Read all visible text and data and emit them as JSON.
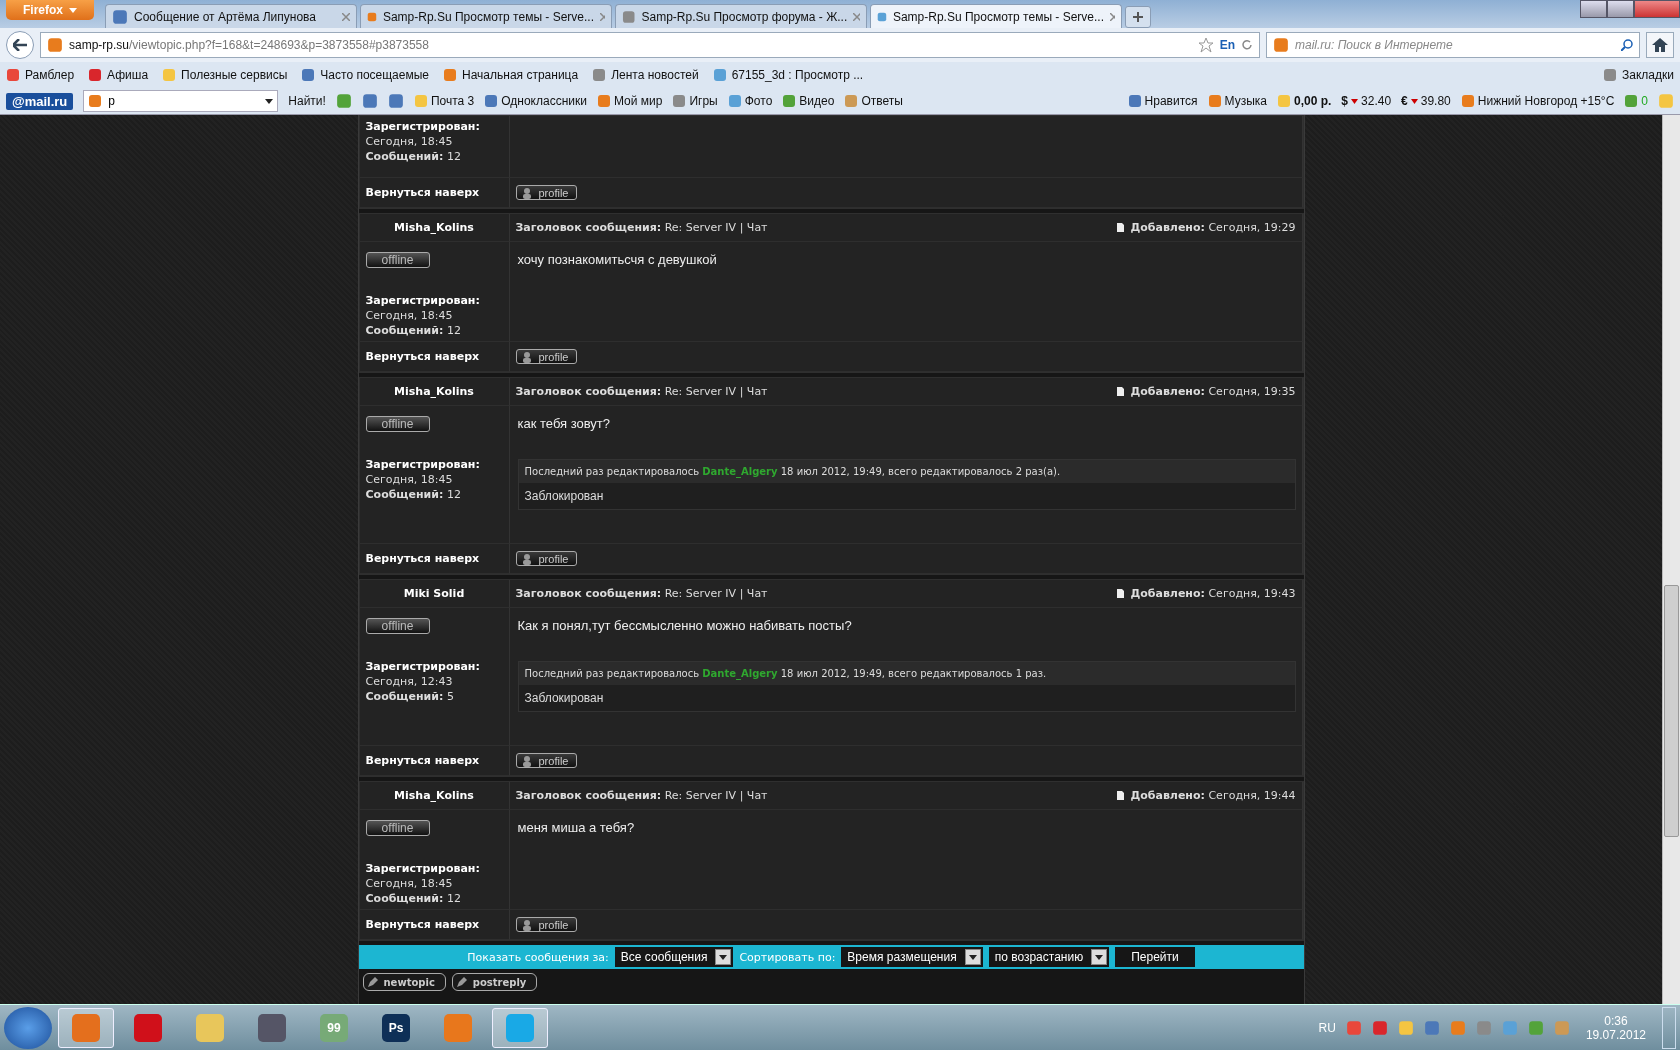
{
  "browser": {
    "menu_button": "Firefox",
    "tabs": [
      {
        "title": "Сообщение от Артёма Липунова",
        "selected": false
      },
      {
        "title": "Samp-Rp.Su Просмотр темы - Serve...",
        "selected": false
      },
      {
        "title": "Samp-Rp.Su Просмотр форума - Ж...",
        "selected": false
      },
      {
        "title": "Samp-Rp.Su Просмотр темы - Serve...",
        "selected": true
      }
    ],
    "address": {
      "host": "samp-rp.su",
      "path": "/viewtopic.php?f=168&t=248693&p=3873558#p3873558"
    },
    "lang_indicator": "En",
    "search_placeholder": "mail.ru: Поиск в Интернете",
    "bookmarks": [
      "Рамблер",
      "Афиша",
      "Полезные сервисы",
      "Часто посещаемые",
      "Начальная страница",
      "Лента новостей",
      "67155_3d : Просмотр ..."
    ],
    "bookmarks_menu": "Закладки",
    "mail_toolbar": {
      "logo": "@mail.ru",
      "search_value": "р",
      "search_button": "Найти!",
      "links": [
        "Почта 3",
        "Одноклассники",
        "Мой мир",
        "Игры",
        "Фото",
        "Видео",
        "Ответы"
      ],
      "right_links": [
        "Нравится",
        "Музыка"
      ],
      "balance": "0,00 р.",
      "rates": [
        {
          "symbol": "$",
          "value": "32.40"
        },
        {
          "symbol": "€",
          "value": "39.80"
        }
      ],
      "weather": "Нижний Новгород +15°C",
      "traffic": "0"
    }
  },
  "forum": {
    "top_partial": {
      "registered_label": "Зарегистрирован:",
      "registered": "Сегодня, 18:45",
      "posts_line": "**Сообщений:** 12",
      "back_to_top": "Вернуться наверх",
      "profile": "profile"
    },
    "posts": [
      {
        "author": "Misha_Kolins",
        "status": "offline",
        "subject": "**Заголовок сообщения:** Re: Server IV | Чат",
        "added": "**Добавлено:** Сегодня, 19:29",
        "text": "хочу познакомитьсчя с девушкой",
        "registered_label": "Зарегистрирован:",
        "registered": "Сегодня, 18:45",
        "posts_line": "**Сообщений:** 12",
        "back_to_top": "Вернуться наверх",
        "profile": "profile"
      },
      {
        "author": "Misha_Kolins",
        "status": "offline",
        "subject": "**Заголовок сообщения:** Re: Server IV | Чат",
        "added": "**Добавлено:** Сегодня, 19:35",
        "text": "как тебя зовут?",
        "edit": {
          "prefix": "Последний раз редактировалось",
          "editor": "Dante_Algery",
          "suffix": "18 июл 2012, 19:49, всего редактировалось 2 раз(а)."
        },
        "signature": "Заблокирован",
        "registered_label": "Зарегистрирован:",
        "registered": "Сегодня, 18:45",
        "posts_line": "**Сообщений:** 12",
        "back_to_top": "Вернуться наверх",
        "profile": "profile"
      },
      {
        "author": "Miki Solid",
        "status": "offline",
        "subject": "**Заголовок сообщения:** Re: Server IV | Чат",
        "added": "**Добавлено:** Сегодня, 19:43",
        "text": "Как я понял,тут бессмысленно можно набивать посты?",
        "edit": {
          "prefix": "Последний раз редактировалось",
          "editor": "Dante_Algery",
          "suffix": "18 июл 2012, 19:49, всего редактировалось 1 раз."
        },
        "signature": "Заблокирован",
        "registered_label": "Зарегистрирован:",
        "registered": "Сегодня, 12:43",
        "posts_line": "**Сообщений:** 5",
        "back_to_top": "Вернуться наверх",
        "profile": "profile"
      },
      {
        "author": "Misha_Kolins",
        "status": "offline",
        "subject": "**Заголовок сообщения:** Re: Server IV | Чат",
        "added": "**Добавлено:** Сегодня, 19:44",
        "text": "меня миша а тебя?",
        "registered_label": "Зарегистрирован:",
        "registered": "Сегодня, 18:45",
        "posts_line": "**Сообщений:** 12",
        "back_to_top": "Вернуться наверх",
        "profile": "profile"
      }
    ],
    "display_bar": {
      "show_label": "Показать сообщения за:",
      "show_value": "Все сообщения",
      "sort_label": "Сортировать по:",
      "sort_value": "Время размещения",
      "order_value": "по возрастанию",
      "go_button": "Перейти"
    },
    "action_buttons": [
      "newtopic",
      "postreply"
    ]
  },
  "taskbar": {
    "apps": [
      {
        "active": true
      },
      {
        "active": false
      },
      {
        "active": false
      },
      {
        "active": false
      },
      {
        "label": "99",
        "active": false
      },
      {
        "label": "Ps",
        "active": false
      },
      {
        "active": false
      },
      {
        "active": true
      }
    ],
    "language": "RU",
    "time": "0:36",
    "date": "19.07.2012"
  }
}
